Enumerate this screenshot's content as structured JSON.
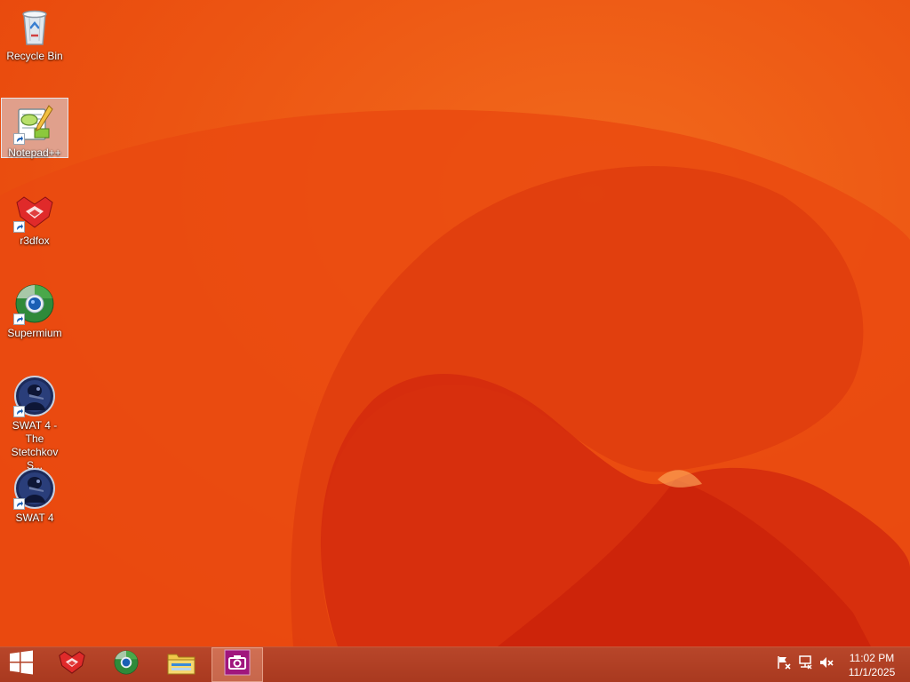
{
  "desktop": {
    "icons": [
      {
        "label": "Recycle Bin",
        "icon": "recycle-bin-icon"
      },
      {
        "label": "Notepad++",
        "icon": "notepad-plus-plus-icon",
        "selected": true
      },
      {
        "label": "r3dfox",
        "icon": "r3dfox-icon"
      },
      {
        "label": "Supermium",
        "icon": "supermium-icon"
      },
      {
        "label": "SWAT 4 - The Stetchkov S...",
        "icon": "swat4-icon"
      },
      {
        "label": "SWAT 4",
        "icon": "swat4-icon"
      }
    ]
  },
  "taskbar": {
    "pinned": [
      {
        "icon": "start-windows-logo-icon"
      },
      {
        "icon": "r3dfox-icon"
      },
      {
        "icon": "supermium-icon"
      },
      {
        "icon": "file-explorer-icon"
      },
      {
        "icon": "camera-app-icon",
        "active": true
      }
    ],
    "tray_icons": [
      "action-center-flag-icon",
      "network-icon",
      "volume-muted-icon"
    ],
    "clock": {
      "time": "11:02 PM",
      "date": "11/1/2025"
    }
  },
  "colors": {
    "wallpaper_base": "#e84a0c",
    "wallpaper_deep": "#d42a10",
    "taskbar": "#b0401f",
    "camera_accent": "#a0167d"
  }
}
